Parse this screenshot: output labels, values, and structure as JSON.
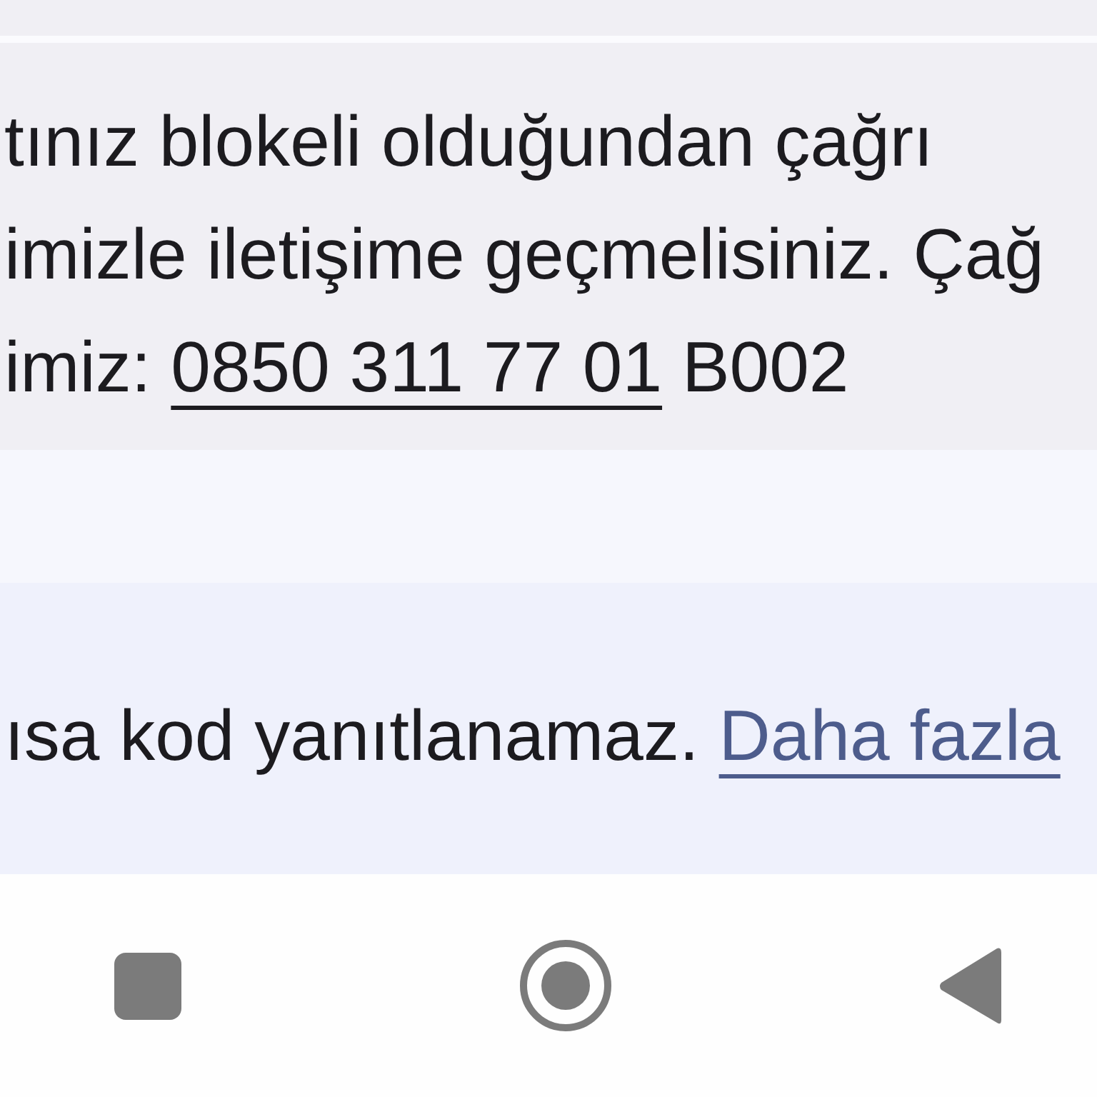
{
  "message": {
    "lines": [
      [
        {
          "kind": "plain",
          "text": "tınız blokeli olduğundan çağrı"
        }
      ],
      [
        {
          "kind": "plain",
          "text": "imizle iletişime geçmelisiniz. Çağ"
        }
      ],
      [
        {
          "kind": "plain",
          "text": "imiz:"
        },
        {
          "kind": "link",
          "text": "0850 311 77 01"
        },
        {
          "kind": "plain",
          "text": "B002"
        }
      ]
    ]
  },
  "notice": {
    "segments": [
      {
        "kind": "plain",
        "text": "ısa kod yanıtlanamaz."
      },
      {
        "kind": "link",
        "text": "Daha fazla"
      }
    ]
  },
  "nav_bar": {
    "buttons": [
      {
        "kind": "recents"
      },
      {
        "kind": "home"
      },
      {
        "kind": "back"
      }
    ]
  }
}
